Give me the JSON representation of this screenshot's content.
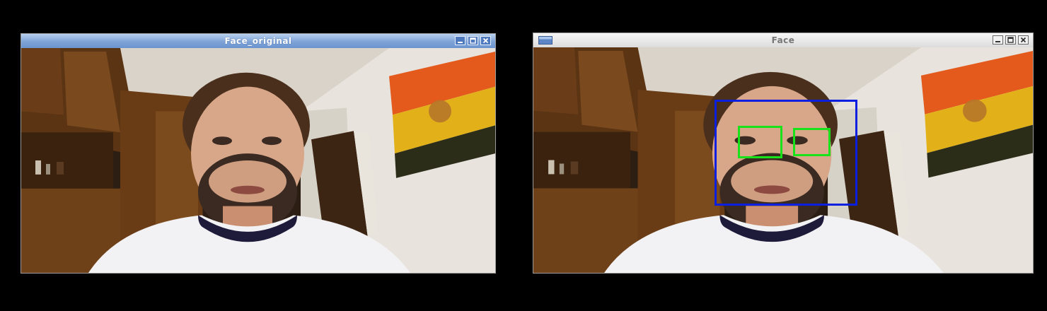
{
  "windows": {
    "original": {
      "title": "Face_original"
    },
    "processed": {
      "title": "Face"
    }
  },
  "detection": {
    "face_color": "#0a1fe0",
    "eye_color": "#18e21a",
    "eyes_detected": 2
  },
  "colors": {
    "title_active": "#7ea3d6",
    "title_inactive": "#dcdcdc",
    "desktop": "#000000"
  },
  "icons": [
    "minimize-icon",
    "maximize-icon",
    "close-icon",
    "app-icon"
  ]
}
